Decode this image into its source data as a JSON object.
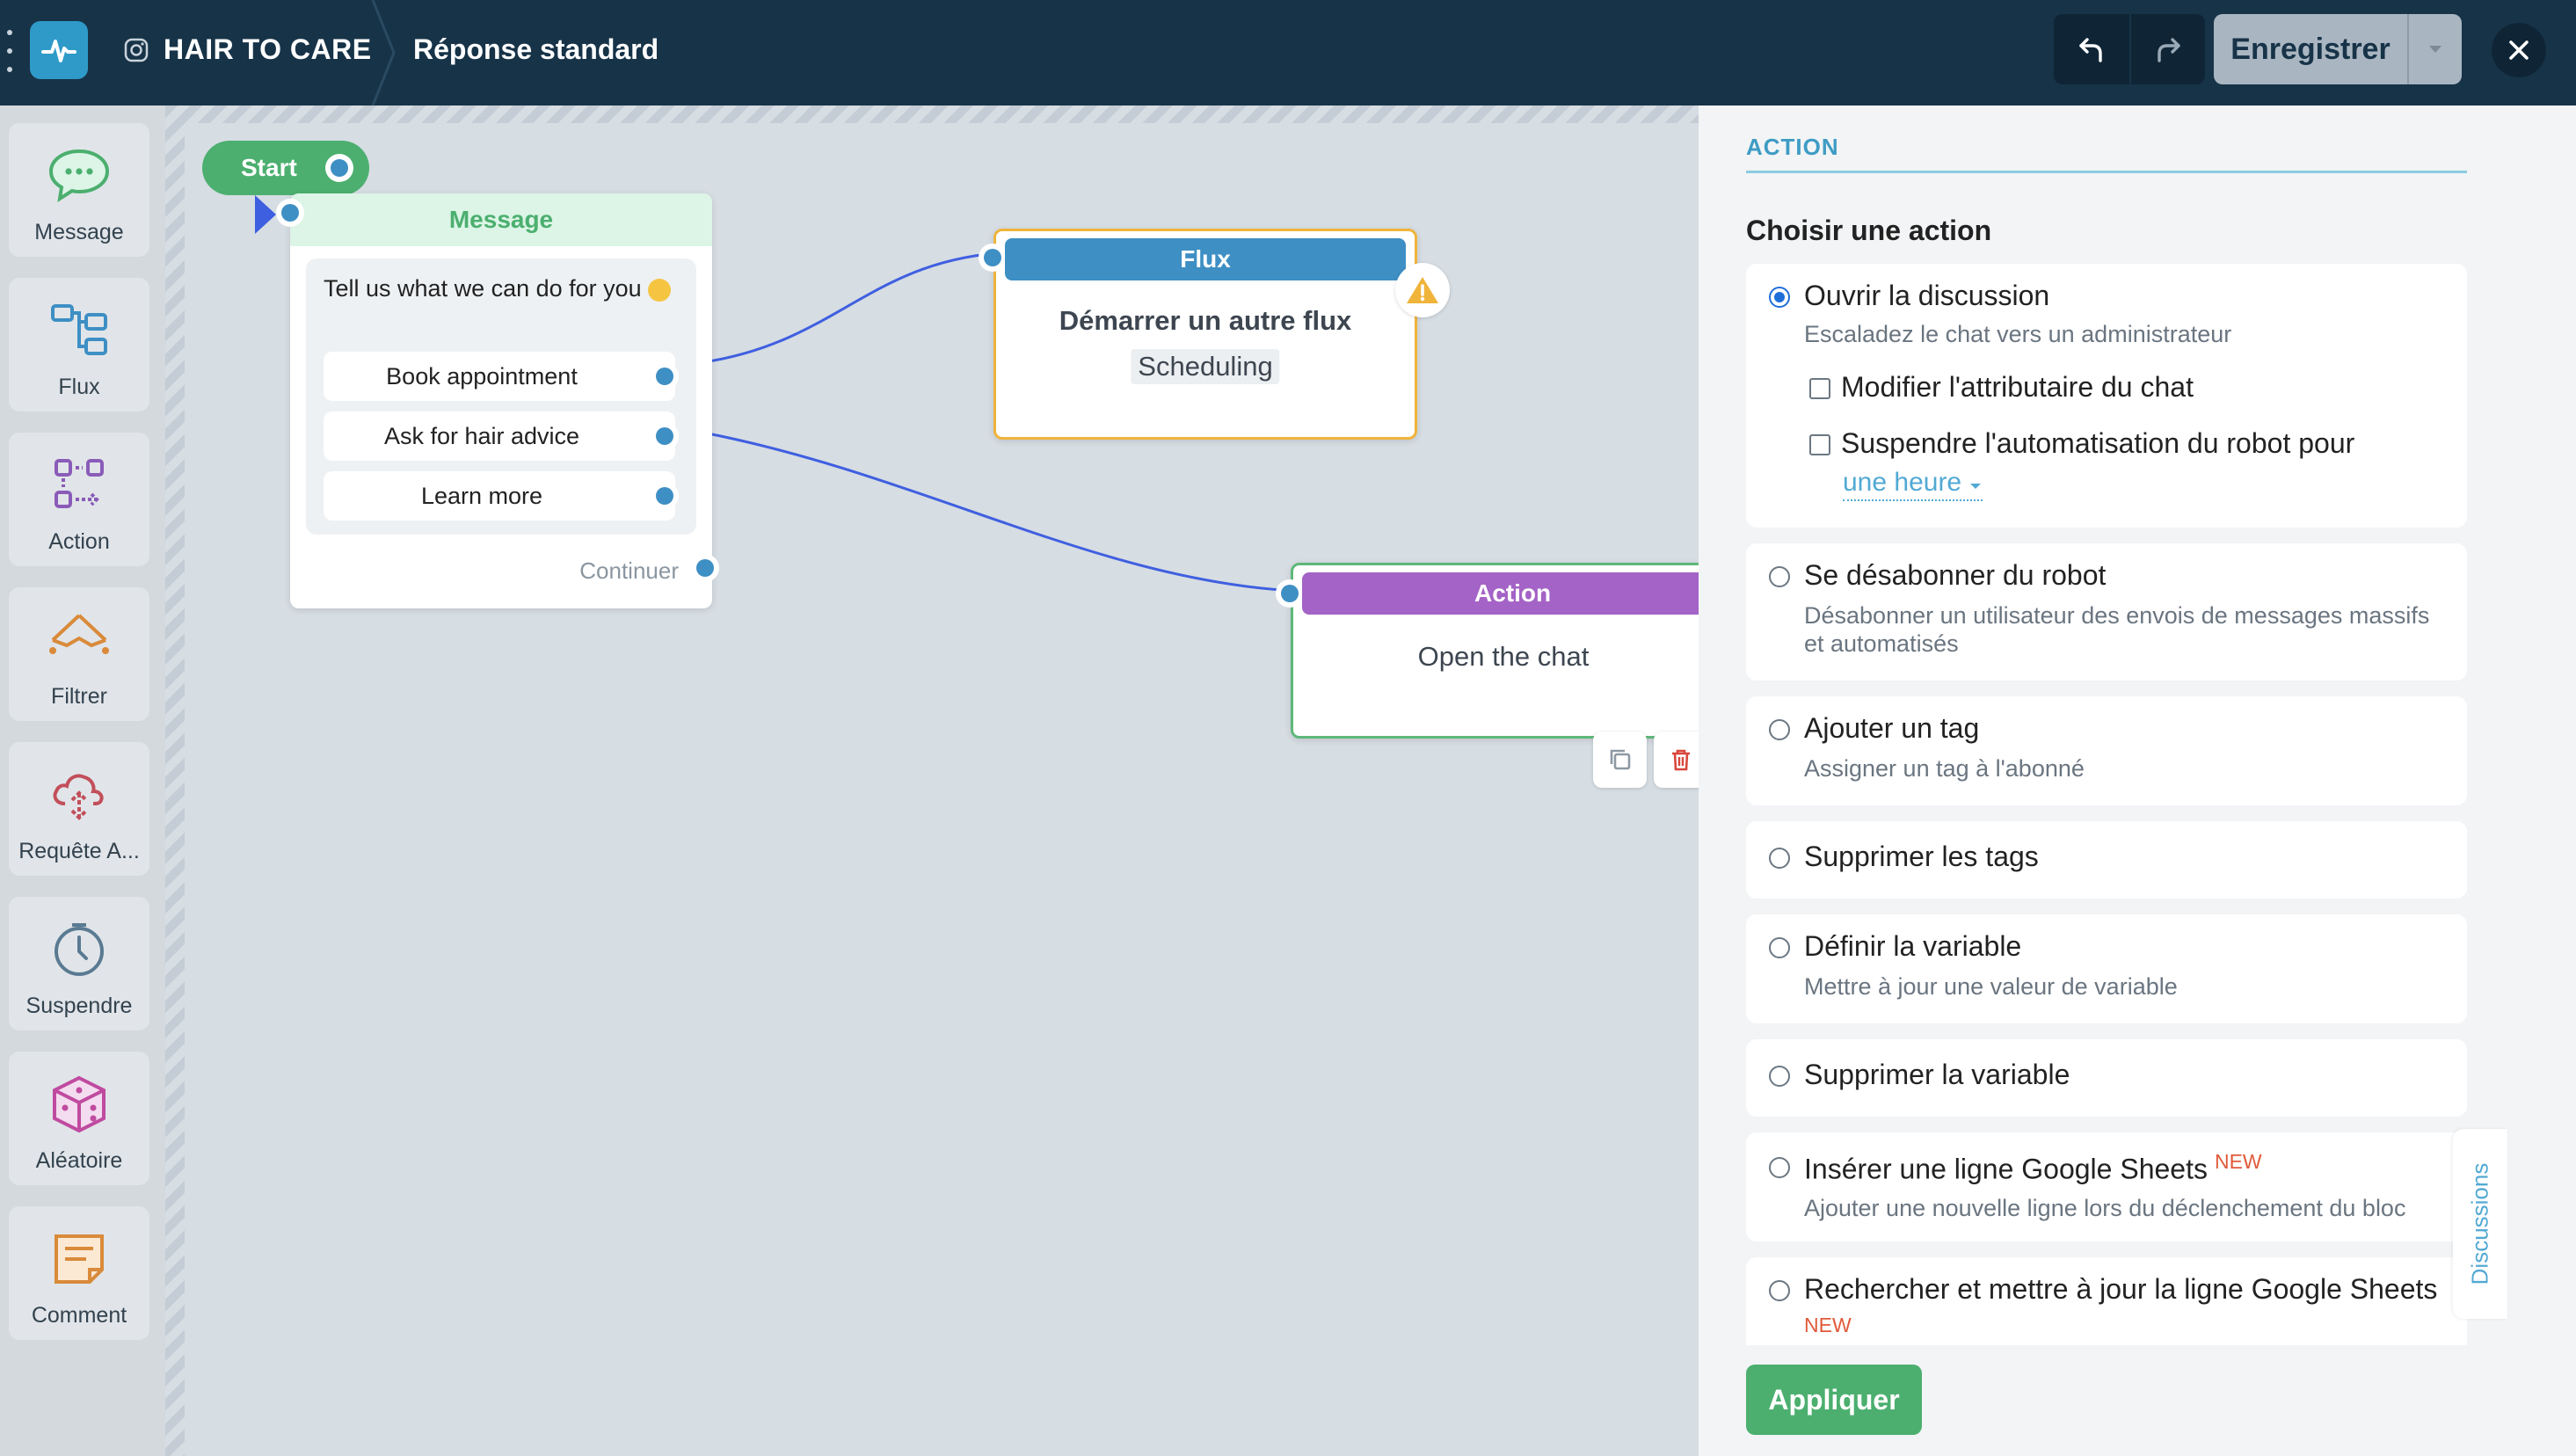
{
  "topbar": {
    "brand": "HAIR TO CARE",
    "flow_name": "Réponse standard",
    "save_label": "Enregistrer"
  },
  "palette": [
    {
      "label": "Message",
      "icon": "chat-bubble-icon",
      "color": "#4caf6f"
    },
    {
      "label": "Flux",
      "icon": "flow-icon",
      "color": "#3e8fc4"
    },
    {
      "label": "Action",
      "icon": "action-icon",
      "color": "#8a5bb8"
    },
    {
      "label": "Filtrer",
      "icon": "filter-icon",
      "color": "#d98a3a"
    },
    {
      "label": "Requête A...",
      "icon": "cloud-request-icon",
      "color": "#c24f5a"
    },
    {
      "label": "Suspendre",
      "icon": "clock-icon",
      "color": "#5a7a92"
    },
    {
      "label": "Aléatoire",
      "icon": "dice-icon",
      "color": "#c04ba0"
    },
    {
      "label": "Comment",
      "icon": "note-icon",
      "color": "#d98a3a"
    }
  ],
  "canvas": {
    "start_label": "Start",
    "message_node": {
      "header": "Message",
      "text": "Tell us what we can do for you",
      "buttons": [
        "Book appointment",
        "Ask for hair advice",
        "Learn more"
      ],
      "continue_label": "Continuer"
    },
    "flux_node": {
      "header": "Flux",
      "title": "Démarrer un autre flux",
      "target": "Scheduling"
    },
    "action_node": {
      "header": "Action",
      "body": "Open the chat"
    }
  },
  "panel": {
    "section_label": "ACTION",
    "heading": "Choisir une action",
    "options": [
      {
        "title": "Ouvrir la discussion",
        "desc": "Escaladez le chat vers un administrateur",
        "selected": true,
        "checkboxes": [
          "Modifier l'attributaire du chat",
          "Suspendre l'automatisation du robot pour"
        ],
        "duration": "une heure"
      },
      {
        "title": "Se désabonner du robot",
        "desc": "Désabonner un utilisateur des envois de messages massifs et automatisés"
      },
      {
        "title": "Ajouter un tag",
        "desc": "Assigner un tag à l'abonné"
      },
      {
        "title": "Supprimer les tags",
        "desc": ""
      },
      {
        "title": "Définir la variable",
        "desc": "Mettre à jour une valeur de variable"
      },
      {
        "title": "Supprimer la variable",
        "desc": ""
      },
      {
        "title": "Insérer une ligne Google Sheets",
        "badge": "NEW",
        "desc": "Ajouter une nouvelle ligne lors du déclenchement du bloc"
      },
      {
        "title": "Rechercher et mettre à jour la ligne Google Sheets",
        "badge": "NEW",
        "desc": ""
      }
    ],
    "apply_label": "Appliquer",
    "discussions_tab": "Discussions"
  },
  "colors": {
    "topbar_bg": "#173348",
    "accent_blue": "#3e8fc4",
    "accent_green": "#4caf6f",
    "action_purple": "#a463c6",
    "warning": "#f0b43a"
  }
}
